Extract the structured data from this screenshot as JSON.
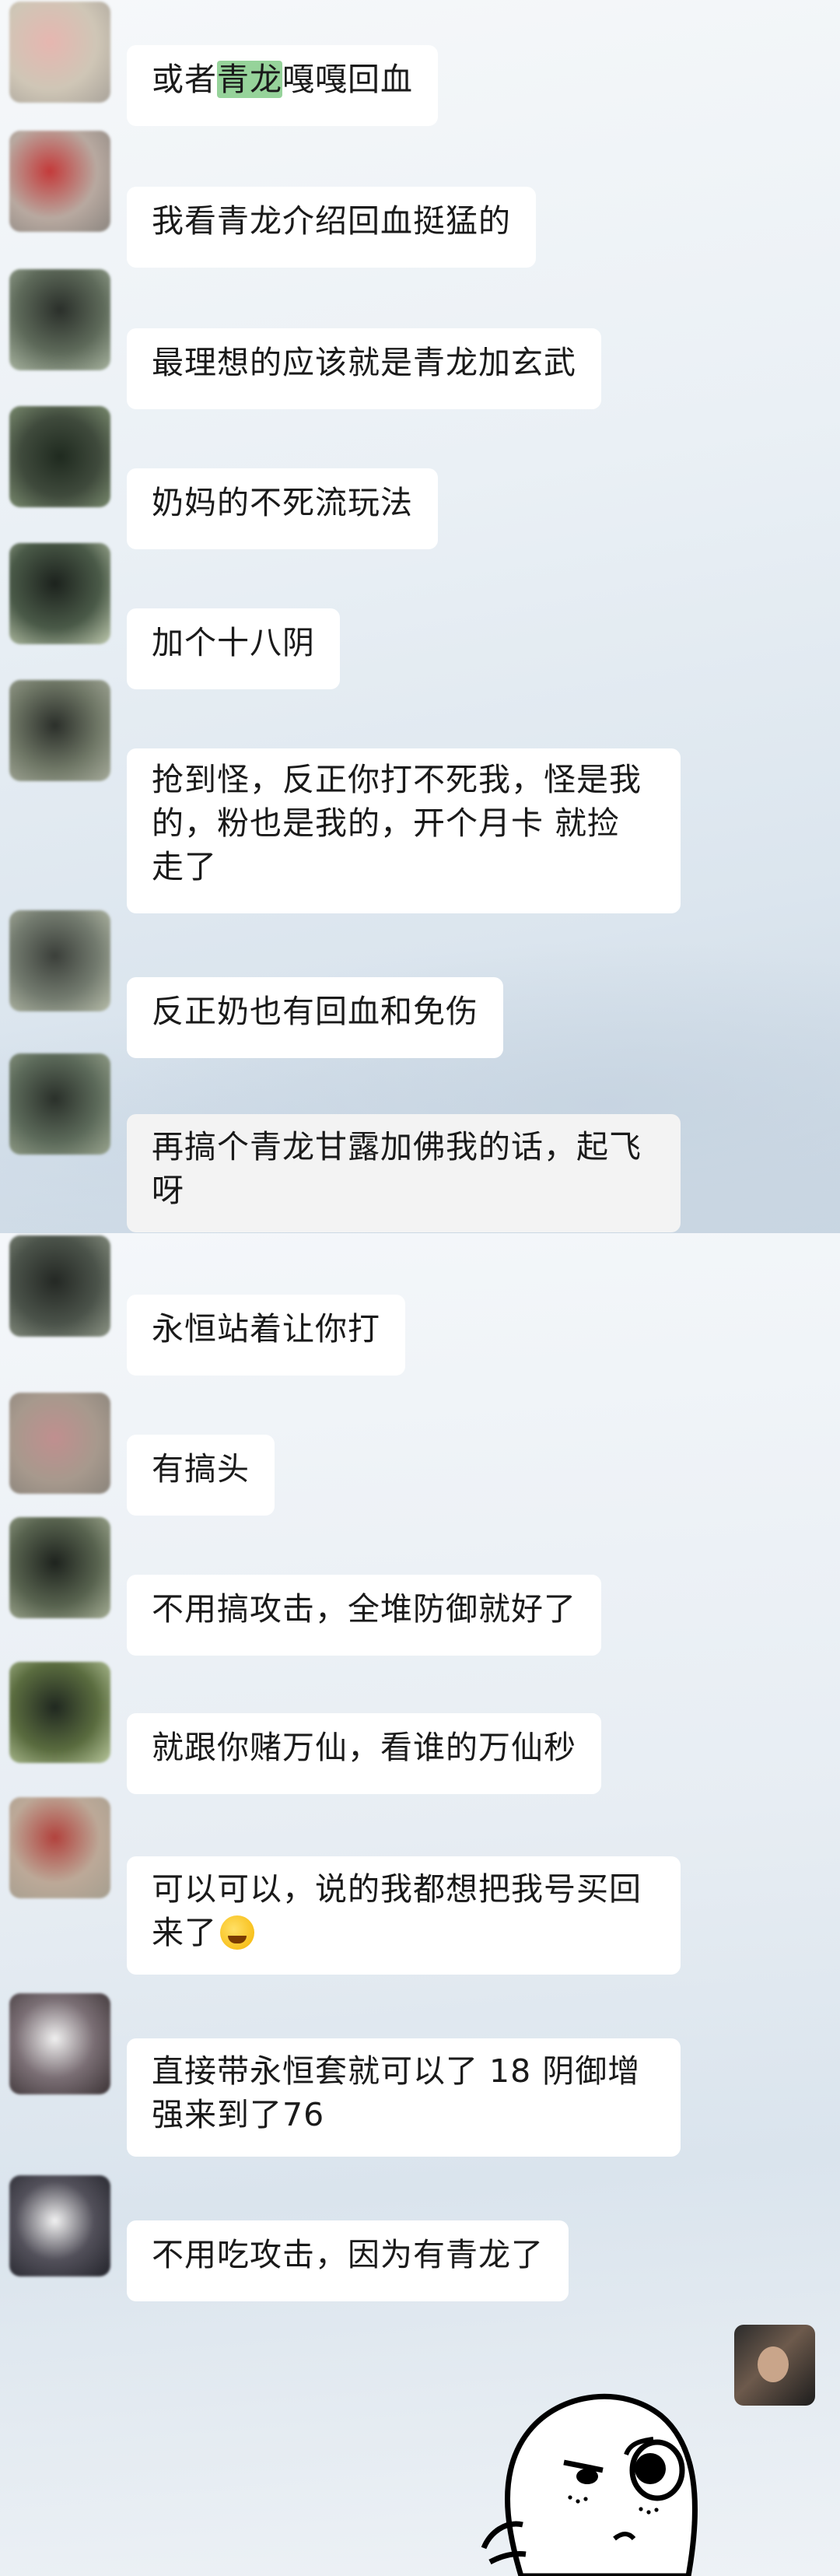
{
  "messages": [
    {
      "text_before": "或者",
      "highlight": "青龙",
      "text_after": "嘎嘎回血"
    },
    {
      "text": "我看青龙介绍回血挺猛的"
    },
    {
      "text": "最理想的应该就是青龙加玄武"
    },
    {
      "text": "奶妈的不死流玩法"
    },
    {
      "text": "加个十八阴"
    },
    {
      "text": "抢到怪，反正你打不死我，怪是我\n的，粉也是我的，开个月卡 就捡\n走了"
    },
    {
      "text": "反正奶也有回血和免伤"
    },
    {
      "text": "再搞个青龙甘露加佛我的话，起飞\n呀"
    },
    {
      "text": "永恒站着让你打"
    },
    {
      "text": "有搞头"
    },
    {
      "text": "不用搞攻击，全堆防御就好了"
    },
    {
      "text": "就跟你赌万仙，看谁的万仙秒"
    },
    {
      "text": "可以可以，说的我都想把我号买回\n来了",
      "emoji": "crying-laughing-emoji"
    },
    {
      "text": "直接带永恒套就可以了 18 阴御增\n强来到了76"
    },
    {
      "text": "不用吃攻击，因为有青龙了"
    }
  ],
  "colors": {
    "bubble": "#ffffff",
    "highlight": "#96d39a"
  }
}
